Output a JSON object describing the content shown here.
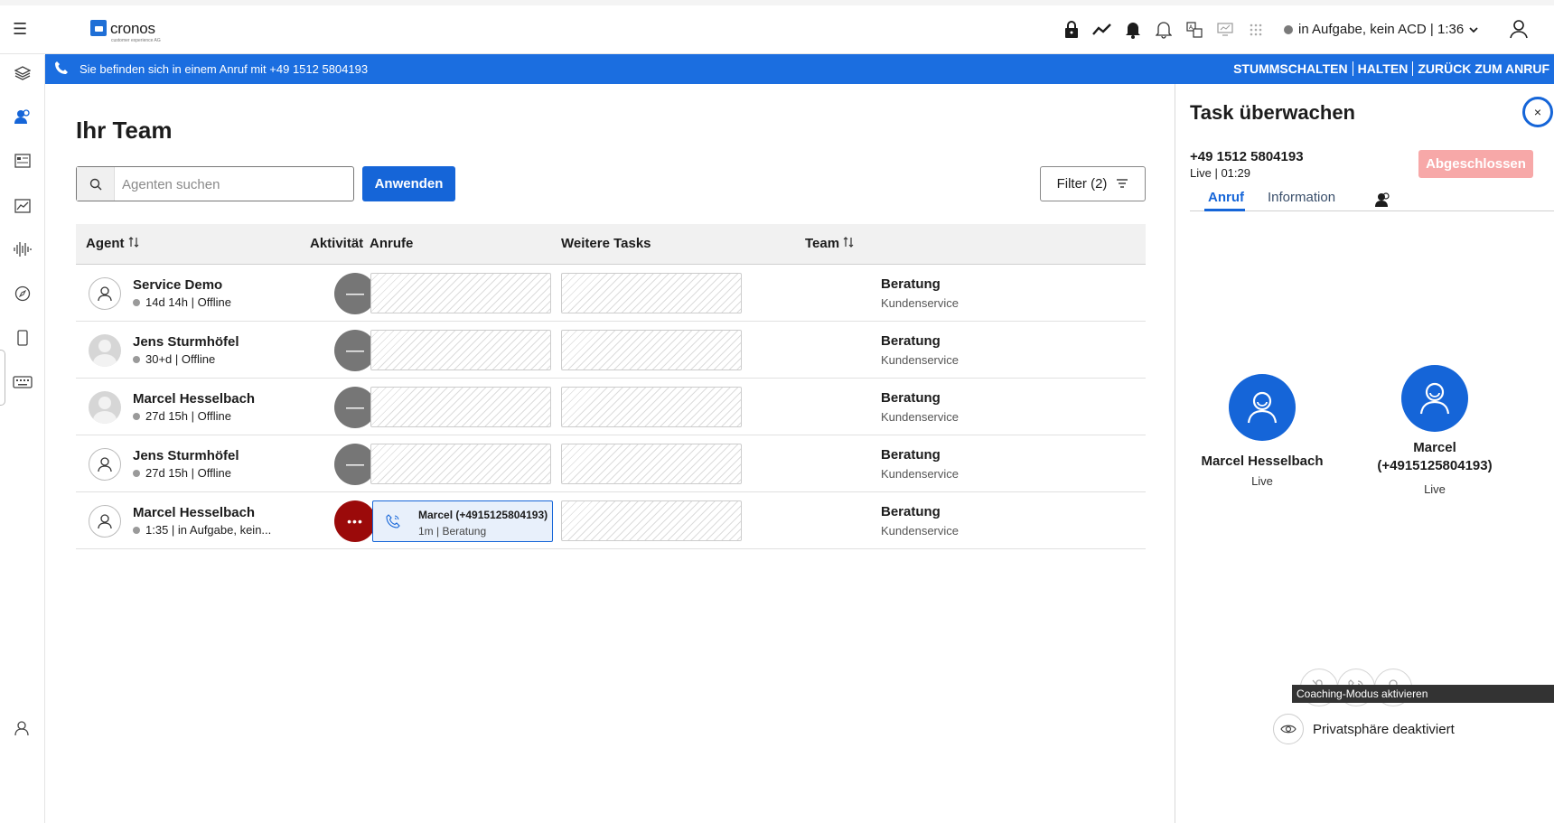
{
  "topbar": {
    "logo_text": "cronos",
    "logo_subtext": "customer experience AG",
    "status_text": "in Aufgabe, kein ACD | 1:36",
    "icons": [
      "lock-icon",
      "trend-icon",
      "bell-filled-icon",
      "bell-icon",
      "translate-icon",
      "screen-icon",
      "grid-icon"
    ]
  },
  "banner": {
    "text": "Sie befinden sich in einem Anruf mit +49 1512 5804193",
    "actions": [
      "STUMMSCHALTEN",
      "HALTEN",
      "ZURÜCK ZUM ANRUF"
    ]
  },
  "main": {
    "title": "Ihr Team",
    "search_placeholder": "Agenten suchen",
    "apply_label": "Anwenden",
    "filter_label": "Filter (2)",
    "columns": {
      "agent": "Agent",
      "activity": "Aktivität",
      "calls": "Anrufe",
      "tasks": "Weitere Tasks",
      "team": "Team"
    },
    "rows": [
      {
        "name": "Service Demo",
        "status": "14d 14h | Offline",
        "team": "Beratung",
        "subteam": "Kundenservice"
      },
      {
        "name": "Jens Sturmhöfel",
        "status": "30+d | Offline",
        "team": "Beratung",
        "subteam": "Kundenservice"
      },
      {
        "name": "Marcel Hesselbach",
        "status": "27d 15h | Offline",
        "team": "Beratung",
        "subteam": "Kundenservice"
      },
      {
        "name": "Jens Sturmhöfel",
        "status": "27d 15h | Offline",
        "team": "Beratung",
        "subteam": "Kundenservice"
      },
      {
        "name": "Marcel Hesselbach",
        "status": "1:35 | in Aufgabe, kein...",
        "team": "Beratung",
        "subteam": "Kundenservice",
        "call_title": "Marcel (+4915125804193)",
        "call_sub": "1m | Beratung"
      }
    ]
  },
  "panel": {
    "title": "Task überwachen",
    "close_symbol": "×",
    "number": "+49 1512 5804193",
    "live": "Live | 01:29",
    "done_label": "Abgeschlossen",
    "tabs": [
      "Anruf",
      "Information"
    ],
    "party1_name": "Marcel Hesselbach",
    "party1_status": "Live",
    "party2_name": "Marcel (+4915125804193)",
    "party2_status": "Live",
    "tooltip": "Coaching-Modus aktivieren",
    "privacy_label": "Privatsphäre deaktiviert"
  },
  "colors": {
    "accent": "#1565d8",
    "banner": "#1b6ee0",
    "busy": "#9b0a0a",
    "offline": "#767676",
    "done": "#f7a8a8"
  }
}
